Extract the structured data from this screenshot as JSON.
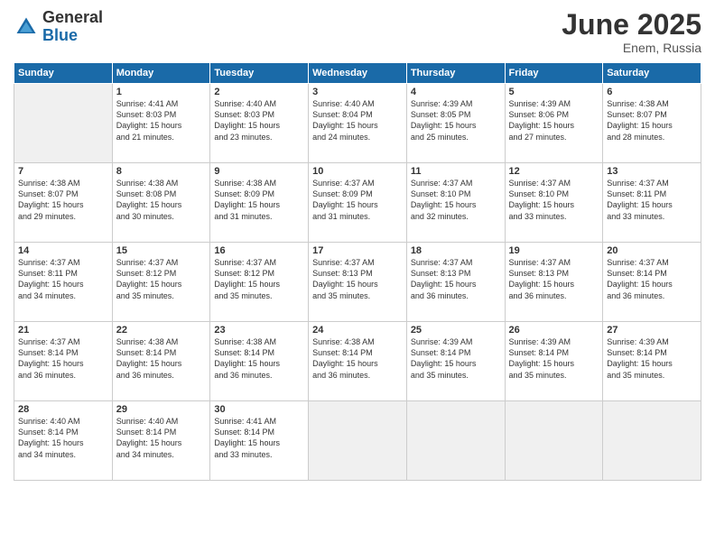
{
  "logo": {
    "general": "General",
    "blue": "Blue"
  },
  "title": "June 2025",
  "subtitle": "Enem, Russia",
  "headers": [
    "Sunday",
    "Monday",
    "Tuesday",
    "Wednesday",
    "Thursday",
    "Friday",
    "Saturday"
  ],
  "days": [
    {
      "num": "",
      "lines": []
    },
    {
      "num": "1",
      "lines": [
        "Sunrise: 4:41 AM",
        "Sunset: 8:03 PM",
        "Daylight: 15 hours",
        "and 21 minutes."
      ]
    },
    {
      "num": "2",
      "lines": [
        "Sunrise: 4:40 AM",
        "Sunset: 8:03 PM",
        "Daylight: 15 hours",
        "and 23 minutes."
      ]
    },
    {
      "num": "3",
      "lines": [
        "Sunrise: 4:40 AM",
        "Sunset: 8:04 PM",
        "Daylight: 15 hours",
        "and 24 minutes."
      ]
    },
    {
      "num": "4",
      "lines": [
        "Sunrise: 4:39 AM",
        "Sunset: 8:05 PM",
        "Daylight: 15 hours",
        "and 25 minutes."
      ]
    },
    {
      "num": "5",
      "lines": [
        "Sunrise: 4:39 AM",
        "Sunset: 8:06 PM",
        "Daylight: 15 hours",
        "and 27 minutes."
      ]
    },
    {
      "num": "6",
      "lines": [
        "Sunrise: 4:38 AM",
        "Sunset: 8:07 PM",
        "Daylight: 15 hours",
        "and 28 minutes."
      ]
    },
    {
      "num": "7",
      "lines": [
        "Sunrise: 4:38 AM",
        "Sunset: 8:07 PM",
        "Daylight: 15 hours",
        "and 29 minutes."
      ]
    },
    {
      "num": "8",
      "lines": [
        "Sunrise: 4:38 AM",
        "Sunset: 8:08 PM",
        "Daylight: 15 hours",
        "and 30 minutes."
      ]
    },
    {
      "num": "9",
      "lines": [
        "Sunrise: 4:38 AM",
        "Sunset: 8:09 PM",
        "Daylight: 15 hours",
        "and 31 minutes."
      ]
    },
    {
      "num": "10",
      "lines": [
        "Sunrise: 4:37 AM",
        "Sunset: 8:09 PM",
        "Daylight: 15 hours",
        "and 31 minutes."
      ]
    },
    {
      "num": "11",
      "lines": [
        "Sunrise: 4:37 AM",
        "Sunset: 8:10 PM",
        "Daylight: 15 hours",
        "and 32 minutes."
      ]
    },
    {
      "num": "12",
      "lines": [
        "Sunrise: 4:37 AM",
        "Sunset: 8:10 PM",
        "Daylight: 15 hours",
        "and 33 minutes."
      ]
    },
    {
      "num": "13",
      "lines": [
        "Sunrise: 4:37 AM",
        "Sunset: 8:11 PM",
        "Daylight: 15 hours",
        "and 33 minutes."
      ]
    },
    {
      "num": "14",
      "lines": [
        "Sunrise: 4:37 AM",
        "Sunset: 8:11 PM",
        "Daylight: 15 hours",
        "and 34 minutes."
      ]
    },
    {
      "num": "15",
      "lines": [
        "Sunrise: 4:37 AM",
        "Sunset: 8:12 PM",
        "Daylight: 15 hours",
        "and 35 minutes."
      ]
    },
    {
      "num": "16",
      "lines": [
        "Sunrise: 4:37 AM",
        "Sunset: 8:12 PM",
        "Daylight: 15 hours",
        "and 35 minutes."
      ]
    },
    {
      "num": "17",
      "lines": [
        "Sunrise: 4:37 AM",
        "Sunset: 8:13 PM",
        "Daylight: 15 hours",
        "and 35 minutes."
      ]
    },
    {
      "num": "18",
      "lines": [
        "Sunrise: 4:37 AM",
        "Sunset: 8:13 PM",
        "Daylight: 15 hours",
        "and 36 minutes."
      ]
    },
    {
      "num": "19",
      "lines": [
        "Sunrise: 4:37 AM",
        "Sunset: 8:13 PM",
        "Daylight: 15 hours",
        "and 36 minutes."
      ]
    },
    {
      "num": "20",
      "lines": [
        "Sunrise: 4:37 AM",
        "Sunset: 8:14 PM",
        "Daylight: 15 hours",
        "and 36 minutes."
      ]
    },
    {
      "num": "21",
      "lines": [
        "Sunrise: 4:37 AM",
        "Sunset: 8:14 PM",
        "Daylight: 15 hours",
        "and 36 minutes."
      ]
    },
    {
      "num": "22",
      "lines": [
        "Sunrise: 4:38 AM",
        "Sunset: 8:14 PM",
        "Daylight: 15 hours",
        "and 36 minutes."
      ]
    },
    {
      "num": "23",
      "lines": [
        "Sunrise: 4:38 AM",
        "Sunset: 8:14 PM",
        "Daylight: 15 hours",
        "and 36 minutes."
      ]
    },
    {
      "num": "24",
      "lines": [
        "Sunrise: 4:38 AM",
        "Sunset: 8:14 PM",
        "Daylight: 15 hours",
        "and 36 minutes."
      ]
    },
    {
      "num": "25",
      "lines": [
        "Sunrise: 4:39 AM",
        "Sunset: 8:14 PM",
        "Daylight: 15 hours",
        "and 35 minutes."
      ]
    },
    {
      "num": "26",
      "lines": [
        "Sunrise: 4:39 AM",
        "Sunset: 8:14 PM",
        "Daylight: 15 hours",
        "and 35 minutes."
      ]
    },
    {
      "num": "27",
      "lines": [
        "Sunrise: 4:39 AM",
        "Sunset: 8:14 PM",
        "Daylight: 15 hours",
        "and 35 minutes."
      ]
    },
    {
      "num": "28",
      "lines": [
        "Sunrise: 4:40 AM",
        "Sunset: 8:14 PM",
        "Daylight: 15 hours",
        "and 34 minutes."
      ]
    },
    {
      "num": "29",
      "lines": [
        "Sunrise: 4:40 AM",
        "Sunset: 8:14 PM",
        "Daylight: 15 hours",
        "and 34 minutes."
      ]
    },
    {
      "num": "30",
      "lines": [
        "Sunrise: 4:41 AM",
        "Sunset: 8:14 PM",
        "Daylight: 15 hours",
        "and 33 minutes."
      ]
    },
    {
      "num": "",
      "lines": []
    },
    {
      "num": "",
      "lines": []
    },
    {
      "num": "",
      "lines": []
    },
    {
      "num": "",
      "lines": []
    }
  ]
}
